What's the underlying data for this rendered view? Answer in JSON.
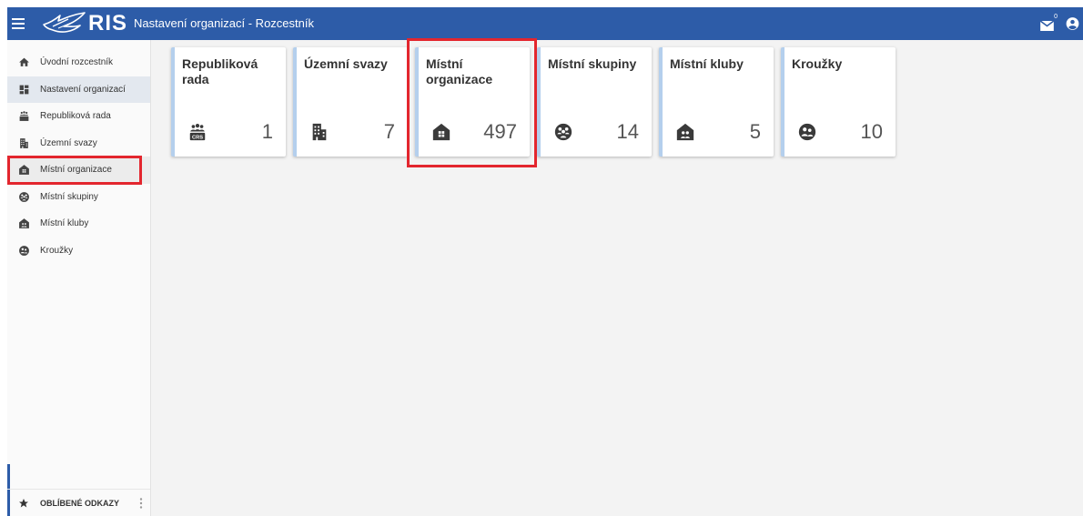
{
  "colors": {
    "header_bg": "#2d5ca8",
    "card_accent": "#b4cfed",
    "nav_active_bg": "#e3e8ef",
    "nav_hover_bg": "#ececec",
    "annotation": "#e3262e",
    "main_bg": "#f3f3f3",
    "sidebar_bg": "#fafafa",
    "icon_dark": "#3a3a3a"
  },
  "header": {
    "menu_icon": "hamburger-icon",
    "logo_icon": "bird-logo-icon",
    "logo_text": "RIS",
    "title": "Nastavení organizací - Rozcestník",
    "mail_icon": "mail-icon",
    "mail_badge": "0",
    "user_icon": "account-circle-icon"
  },
  "sidebar": {
    "items": [
      {
        "label": "Úvodní rozcestník",
        "icon": "home-icon"
      },
      {
        "label": "Nastavení organizací",
        "icon": "dashboard-icon"
      },
      {
        "label": "Republiková rada",
        "icon": "council-group-icon"
      },
      {
        "label": "Územní svazy",
        "icon": "building-icon"
      },
      {
        "label": "Místní organizace",
        "icon": "house-grid-icon"
      },
      {
        "label": "Místní skupiny",
        "icon": "circle-group-icon"
      },
      {
        "label": "Místní kluby",
        "icon": "house-people-icon"
      },
      {
        "label": "Kroužky",
        "icon": "circle-people-icon"
      }
    ],
    "favorites": {
      "icon": "star-icon",
      "label": "OBLÍBENÉ ODKAZY",
      "menu_icon": "kebab-menu-icon"
    }
  },
  "cards": [
    {
      "title": "Republiková rada",
      "count": 1,
      "icon": "council-group-icon",
      "badge_text": "CRS"
    },
    {
      "title": "Územní svazy",
      "count": 7,
      "icon": "building-icon"
    },
    {
      "title": "Místní organizace",
      "count": 497,
      "icon": "house-grid-icon"
    },
    {
      "title": "Místní skupiny",
      "count": 14,
      "icon": "circle-group-icon"
    },
    {
      "title": "Místní kluby",
      "count": 5,
      "icon": "house-people-icon"
    },
    {
      "title": "Kroužky",
      "count": 10,
      "icon": "circle-people-icon"
    }
  ]
}
